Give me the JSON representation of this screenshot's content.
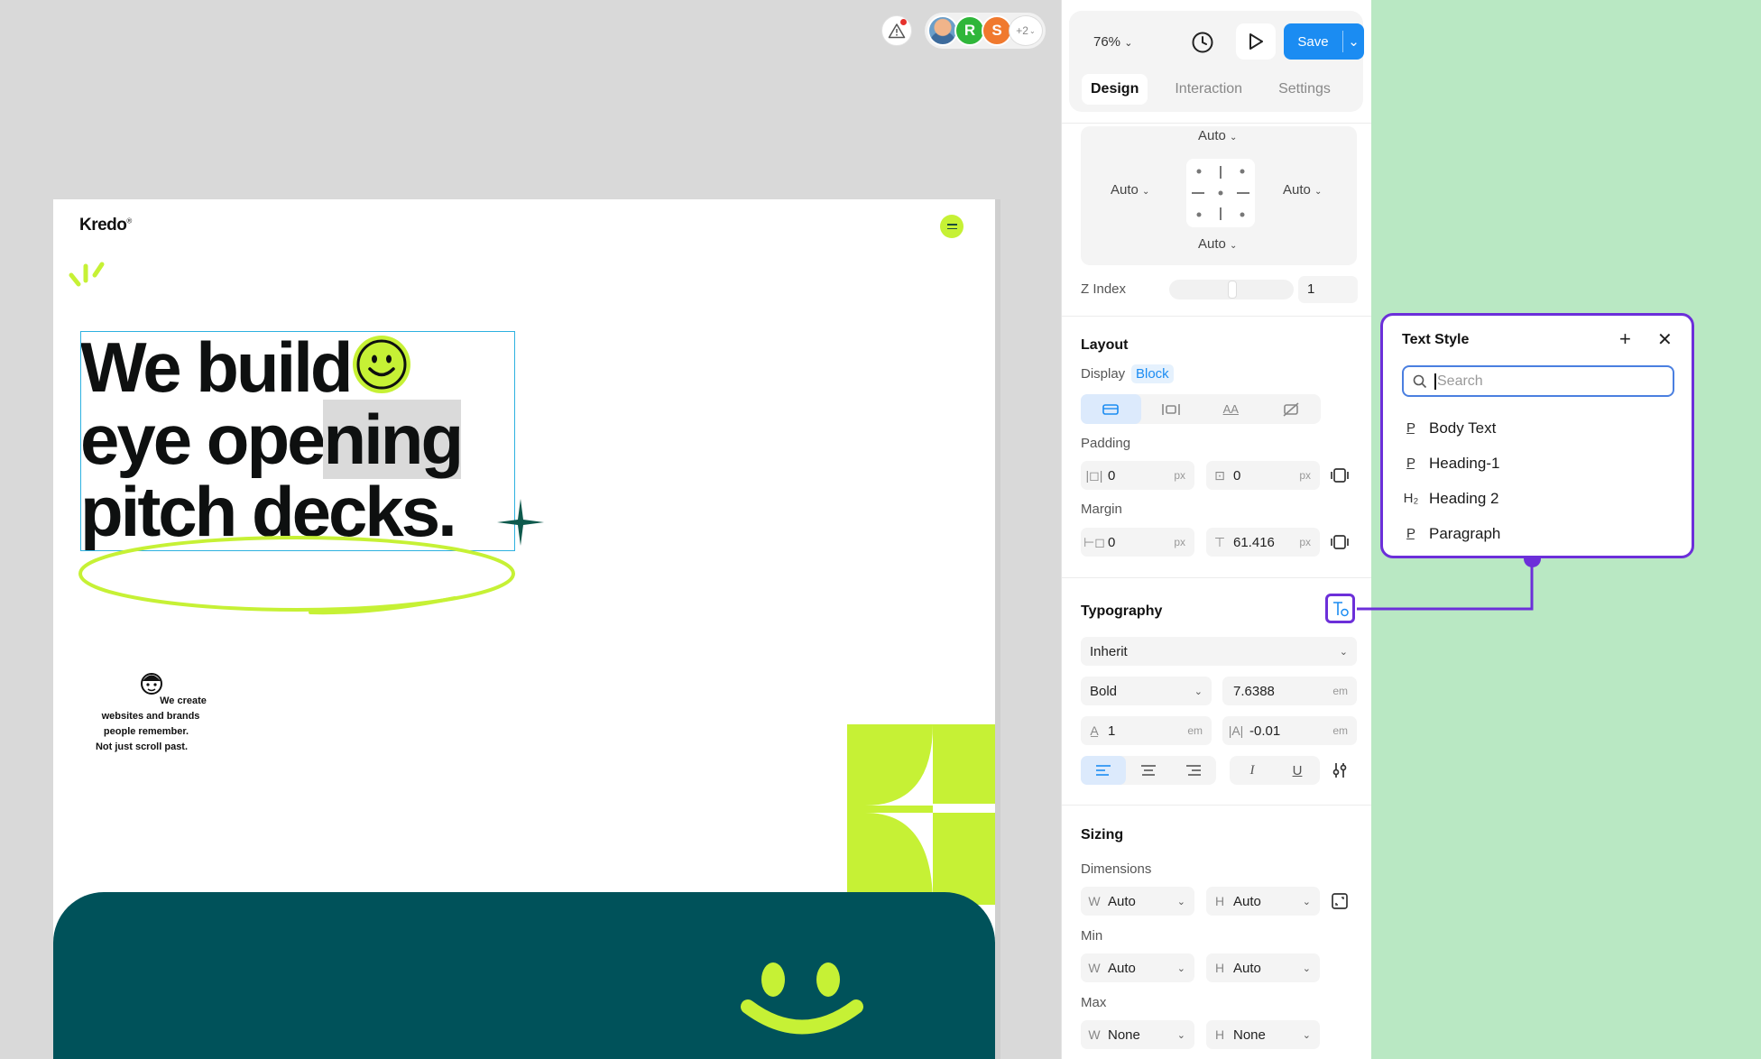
{
  "canvas": {
    "collaborators": {
      "avatar_r": "R",
      "avatar_s": "S",
      "more_count": "+2"
    },
    "artboard": {
      "logo": "Kredo",
      "logo_mark": "®",
      "headline": [
        "We build",
        "eye ope",
        "ning",
        "pitch decks."
      ],
      "tagline_lines": [
        "We create",
        "websites and brands",
        "people remember.",
        "Not just scroll past."
      ],
      "colors": {
        "accent_lime": "#c6f135",
        "band_teal": "#00525a",
        "selection": "#2eb1e0"
      }
    }
  },
  "panel": {
    "zoom": "76%",
    "save_label": "Save",
    "tabs": [
      "Design",
      "Interaction",
      "Settings"
    ],
    "position": {
      "top": "Auto",
      "left": "Auto",
      "right": "Auto",
      "bottom": "Auto"
    },
    "z_index_label": "Z Index",
    "z_index_value": "1",
    "layout": {
      "title": "Layout",
      "display_label": "Display",
      "display_value": "Block",
      "padding_label": "Padding",
      "padding_x": "0",
      "padding_y": "0",
      "margin_label": "Margin",
      "margin_x": "0",
      "margin_y": "61.416",
      "unit_px": "px"
    },
    "typography": {
      "title": "Typography",
      "font_family": "Inherit",
      "font_weight": "Bold",
      "font_size": "7.6388",
      "line_height": "1",
      "letter_spacing": "-0.01",
      "unit_em": "em"
    },
    "sizing": {
      "title": "Sizing",
      "dimensions_label": "Dimensions",
      "min_label": "Min",
      "max_label": "Max",
      "w": "W",
      "h": "H",
      "dim_w": "Auto",
      "dim_h": "Auto",
      "min_w": "Auto",
      "min_h": "Auto",
      "max_w": "None",
      "max_h": "None"
    },
    "colors": {
      "primary_blue": "#1b8cf2",
      "highlight_purple": "#6c2fd9"
    }
  },
  "text_style_popover": {
    "title": "Text Style",
    "search_placeholder": "Search",
    "items": [
      {
        "icon": "paragraph-style-icon",
        "glyph": "P̲",
        "label": "Body Text"
      },
      {
        "icon": "paragraph-style-icon",
        "glyph": "P̲",
        "label": "Heading-1"
      },
      {
        "icon": "heading-2-icon",
        "glyph": "H₂",
        "label": "Heading 2"
      },
      {
        "icon": "paragraph-style-icon",
        "glyph": "P̲",
        "label": "Paragraph"
      }
    ]
  }
}
